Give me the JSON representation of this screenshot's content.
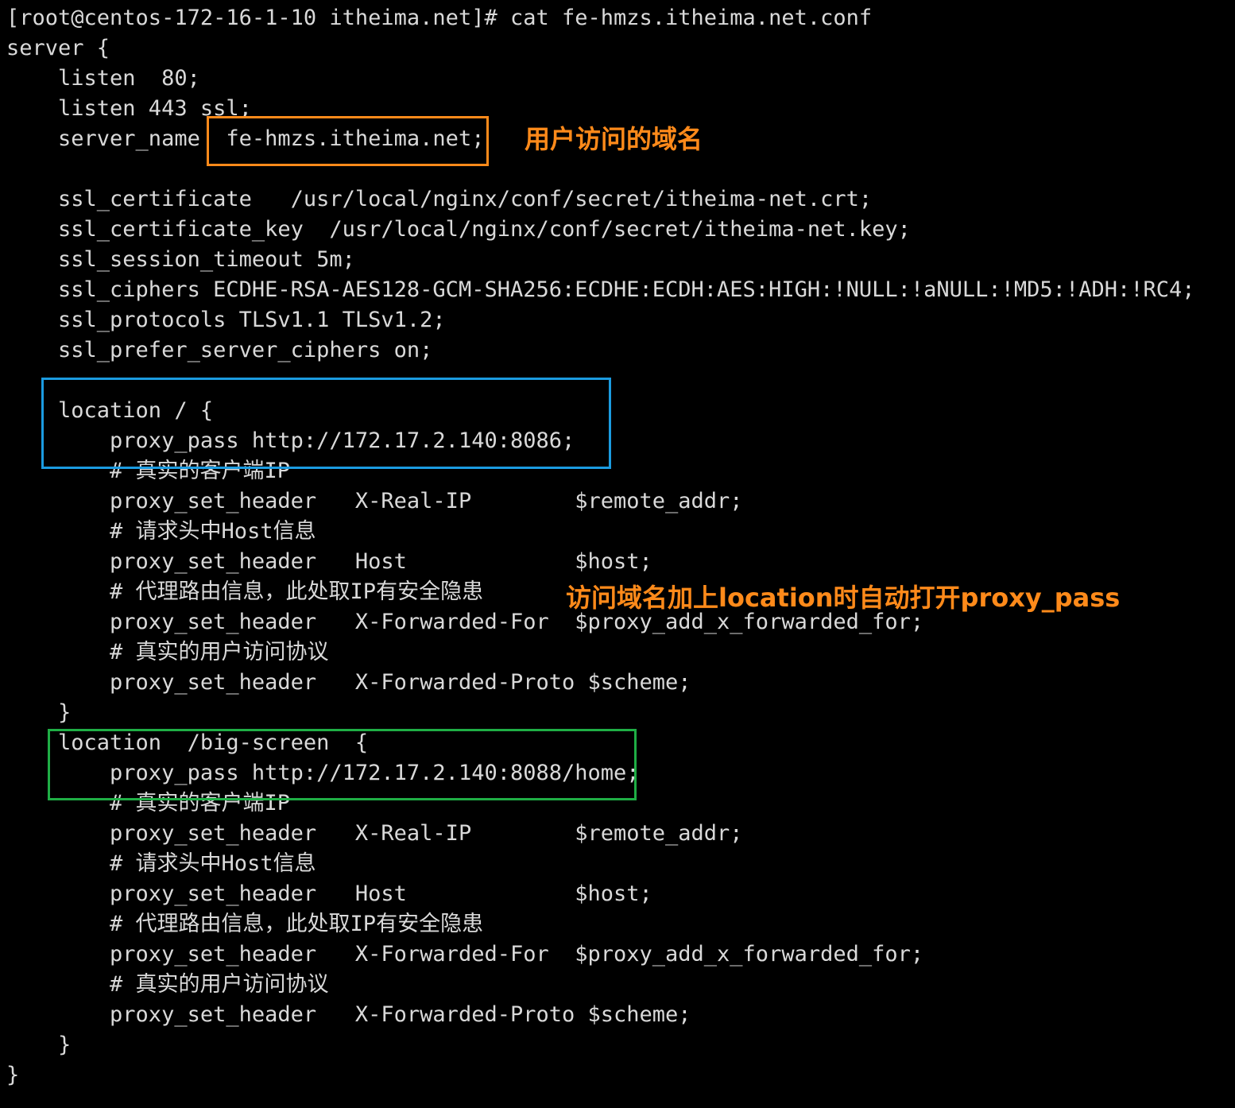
{
  "terminal": {
    "lines": [
      "[root@centos-172-16-1-10 itheima.net]# cat fe-hmzs.itheima.net.conf",
      "server {",
      "    listen  80;",
      "    listen 443 ssl;",
      "    server_name  fe-hmzs.itheima.net;",
      "",
      "    ssl_certificate   /usr/local/nginx/conf/secret/itheima-net.crt;",
      "    ssl_certificate_key  /usr/local/nginx/conf/secret/itheima-net.key;",
      "    ssl_session_timeout 5m;",
      "    ssl_ciphers ECDHE-RSA-AES128-GCM-SHA256:ECDHE:ECDH:AES:HIGH:!NULL:!aNULL:!MD5:!ADH:!RC4;",
      "    ssl_protocols TLSv1.1 TLSv1.2;",
      "    ssl_prefer_server_ciphers on;",
      "",
      "    location / {",
      "        proxy_pass http://172.17.2.140:8086;",
      "        # 真实的客户端IP",
      "        proxy_set_header   X-Real-IP        $remote_addr;",
      "        # 请求头中Host信息",
      "        proxy_set_header   Host             $host;",
      "        # 代理路由信息，此处取IP有安全隐患",
      "        proxy_set_header   X-Forwarded-For  $proxy_add_x_forwarded_for;",
      "        # 真实的用户访问协议",
      "        proxy_set_header   X-Forwarded-Proto $scheme;",
      "    }",
      "    location  /big-screen  {",
      "        proxy_pass http://172.17.2.140:8088/home;",
      "        # 真实的客户端IP",
      "        proxy_set_header   X-Real-IP        $remote_addr;",
      "        # 请求头中Host信息",
      "        proxy_set_header   Host             $host;",
      "        # 代理路由信息，此处取IP有安全隐患",
      "        proxy_set_header   X-Forwarded-For  $proxy_add_x_forwarded_for;",
      "        # 真实的用户访问协议",
      "        proxy_set_header   X-Forwarded-Proto $scheme;",
      "    }",
      "}"
    ]
  },
  "annotations": {
    "domain_label": "用户访问的域名",
    "location_label": "访问域名加上location时自动打开proxy_pass"
  },
  "colors": {
    "background": "#000000",
    "text": "#d9d9d9",
    "orange": "#ff8a1a",
    "blue": "#1b9be0",
    "green": "#1fae45"
  }
}
